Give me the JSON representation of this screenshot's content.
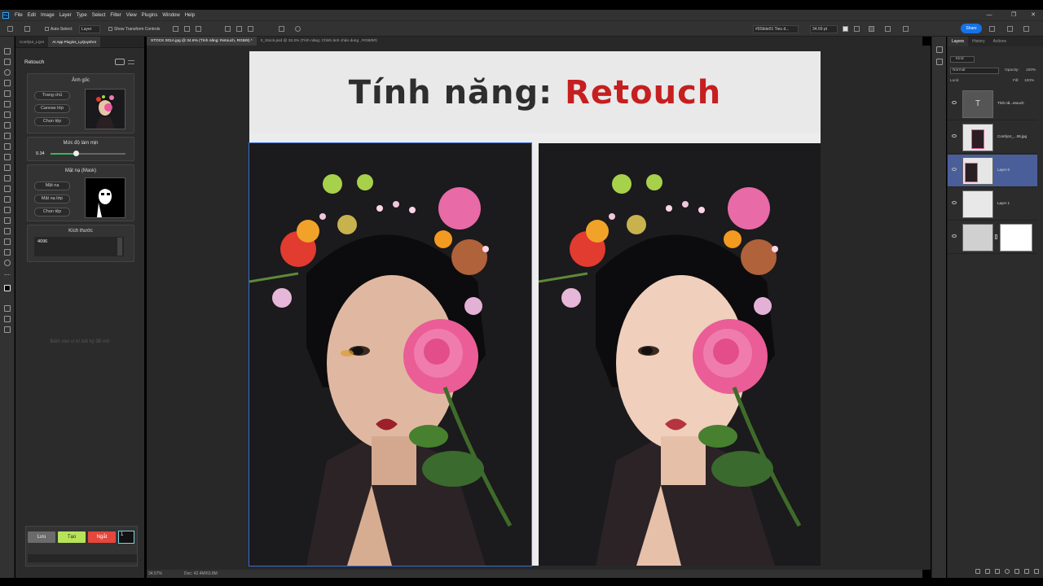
{
  "menu": [
    "File",
    "Edit",
    "Image",
    "Layer",
    "Type",
    "Select",
    "Filter",
    "View",
    "Plugins",
    "Window",
    "Help"
  ],
  "window_controls": [
    "—",
    "❐",
    "✕"
  ],
  "options": {
    "auto_select": "Auto-Select:",
    "auto_select_value": "Layer",
    "show_transform": "Show Transform Controls",
    "font_family": "#9Slide01 Tieu d...",
    "font_size": "34.69 pt",
    "share": "Share"
  },
  "plugin": {
    "tabs": [
      "ComfyUI_LQAI",
      "AI App Plugins_LyQuynhAI"
    ],
    "title": "Retouch",
    "anh_goc": {
      "title": "Ảnh gốc",
      "buttons": [
        "Trang chủ",
        "Canvas lớp",
        "Chọn tệp"
      ]
    },
    "smooth": {
      "title": "Mức độ làm mịn",
      "value": "0.34",
      "level": 0.34
    },
    "mask": {
      "title": "Mặt nạ (Mask)",
      "buttons": [
        "Mặt nạ",
        "Mặt nạ lớp",
        "Chọn tệp"
      ]
    },
    "size": {
      "title": "Kích thước",
      "value": "4096"
    },
    "hint": "Bấm vào vị trí bất kỳ để mở",
    "bottom_buttons": {
      "list": "Lưu",
      "create": "Tạo",
      "stop": "Ngắt",
      "count": "1"
    }
  },
  "doc_tabs": [
    "STOCK 001A.jpg @ 34.6% (Tính năng: Retouch, RGB/8) *",
    "0_Stock.psd @ 33.3% (Tính năng: Chỉnh ảnh chân dung , RGB/8#)"
  ],
  "doc": {
    "title_plain": "Tính năng: ",
    "title_accent": "Retouch"
  },
  "status": {
    "zoom": "34.57%",
    "doc_size": "Doc: 42.4M/63.8M"
  },
  "layers_panel": {
    "tabs": [
      "Layers",
      "History",
      "Actions"
    ],
    "kind": "Kind",
    "blend": "Normal",
    "opacity_label": "Opacity:",
    "opacity": "100%",
    "lock_label": "Lock:",
    "fill_label": "Fill:",
    "fill": "100%",
    "layers": [
      {
        "name": "Tính nă...etouch",
        "thumb": "T"
      },
      {
        "name": "ComfyUI_...08.jpg",
        "thumb": ""
      },
      {
        "name": "Layer 0",
        "thumb": ""
      },
      {
        "name": "Layer 1",
        "thumb": ""
      },
      {
        "name": "",
        "thumb": ""
      }
    ]
  },
  "colors": {
    "accent_red": "#c51f20",
    "title_dark": "#2e2e2e",
    "btn_gray": "#6b6b6b",
    "btn_green": "#b7e35a",
    "btn_red": "#e5473d",
    "share_blue": "#1473e6",
    "selected_layer": "#4a5e9a"
  }
}
